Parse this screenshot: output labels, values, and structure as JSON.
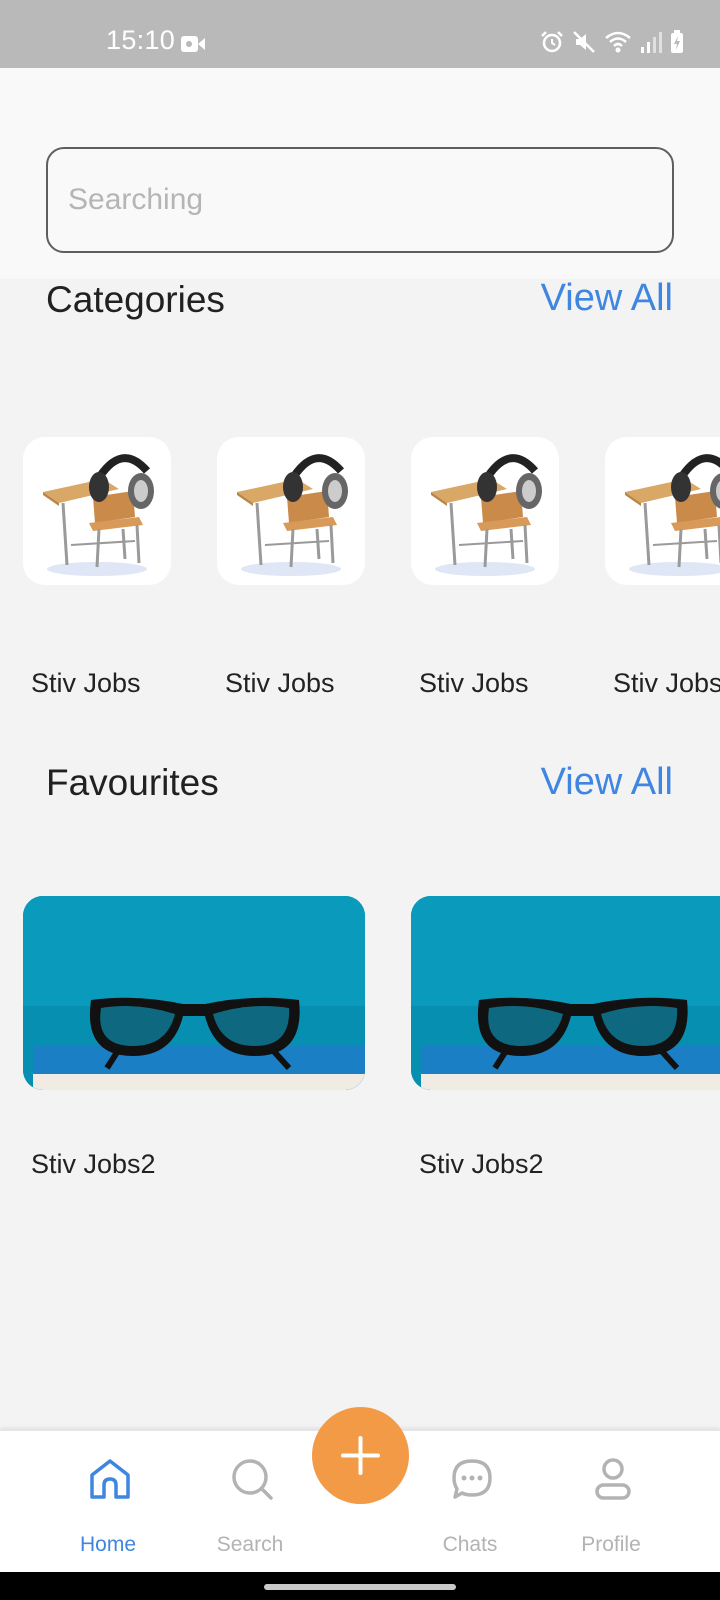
{
  "status_bar": {
    "time": "15:10"
  },
  "search": {
    "placeholder": "Searching",
    "value": ""
  },
  "categories": {
    "title": "Categories",
    "view_all_label": "View All",
    "items": [
      {
        "label": "Stiv Jobs",
        "image": "school-desk-with-headphones"
      },
      {
        "label": "Stiv Jobs",
        "image": "school-desk-with-headphones"
      },
      {
        "label": "Stiv Jobs",
        "image": "school-desk-with-headphones"
      },
      {
        "label": "Stiv Jobs",
        "image": "school-desk-with-headphones"
      }
    ]
  },
  "favourites": {
    "title": "Favourites",
    "view_all_label": "View All",
    "items": [
      {
        "label": "Stiv Jobs2",
        "image": "glasses-on-book"
      },
      {
        "label": "Stiv Jobs2",
        "image": "glasses-on-book"
      }
    ]
  },
  "bottom_nav": {
    "items": [
      {
        "label": "Home",
        "icon": "home-icon",
        "active": true
      },
      {
        "label": "Search",
        "icon": "search-icon",
        "active": false
      },
      {
        "label": "Chats",
        "icon": "chat-icon",
        "active": false
      },
      {
        "label": "Profile",
        "icon": "profile-icon",
        "active": false
      }
    ],
    "fab_icon": "plus-icon"
  },
  "colors": {
    "accent": "#3f86e0",
    "fab": "#f29a46",
    "inactive": "#b3b3b3",
    "status_bar": "#b9b9b9"
  }
}
